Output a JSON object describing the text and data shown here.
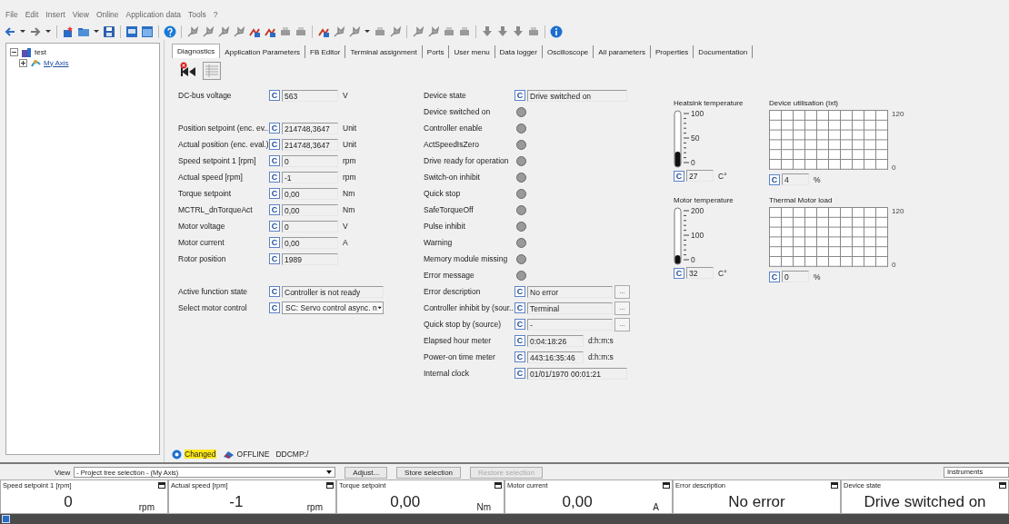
{
  "menu": [
    "File",
    "Edit",
    "Insert",
    "View",
    "Online",
    "Application data",
    "Tools",
    "?"
  ],
  "tree": [
    {
      "label": "test",
      "expanded": true,
      "children": [
        {
          "label": "My Axis",
          "expanded": false,
          "selected": true
        }
      ]
    }
  ],
  "tabs": [
    {
      "label": "Diagnostics",
      "selected": true
    },
    {
      "label": "Application Parameters",
      "selected": false
    },
    {
      "label": "FB Editor",
      "selected": false
    },
    {
      "label": "Terminal assignment",
      "selected": false
    },
    {
      "label": "Ports",
      "selected": false
    },
    {
      "label": "User menu",
      "selected": false
    },
    {
      "label": "Data logger",
      "selected": false
    },
    {
      "label": "Oscilloscope",
      "selected": false
    },
    {
      "label": "All parameters",
      "selected": false
    },
    {
      "label": "Properties",
      "selected": false
    },
    {
      "label": "Documentation",
      "selected": false
    }
  ],
  "diagnostics": {
    "rows": [
      {
        "left": {
          "kind": "value",
          "label": "DC-bus voltage",
          "flag": "C",
          "value": "563",
          "unit": "V"
        },
        "right": {
          "kind": "text",
          "label": "Device state",
          "flag": "C",
          "value": "Drive switched on"
        }
      },
      {
        "right": {
          "kind": "led",
          "label": "Device switched on",
          "on": false
        }
      },
      {
        "left": {
          "kind": "value",
          "label": "Position setpoint (enc. ev..",
          "flag": "C",
          "value": "214748,3647",
          "unit": "Unit"
        },
        "right": {
          "kind": "led",
          "label": "Controller enable",
          "on": false
        }
      },
      {
        "left": {
          "kind": "value",
          "label": "Actual position (enc. eval.)",
          "flag": "C",
          "value": "214748,3647",
          "unit": "Unit"
        },
        "right": {
          "kind": "led",
          "label": "ActSpeedIsZero",
          "on": false
        }
      },
      {
        "left": {
          "kind": "value",
          "label": "Speed setpoint 1 [rpm]",
          "flag": "C",
          "value": "0",
          "unit": "rpm"
        },
        "right": {
          "kind": "led",
          "label": "Drive ready for operation",
          "on": false
        }
      },
      {
        "left": {
          "kind": "value",
          "label": "Actual speed [rpm]",
          "flag": "C",
          "value": "-1",
          "unit": "rpm"
        },
        "right": {
          "kind": "led",
          "label": "Switch-on inhibit",
          "on": false
        }
      },
      {
        "left": {
          "kind": "value",
          "label": "Torque setpoint",
          "flag": "C",
          "value": "0,00",
          "unit": "Nm"
        },
        "right": {
          "kind": "led",
          "label": "Quick stop",
          "on": false
        }
      },
      {
        "left": {
          "kind": "value",
          "label": "MCTRL_dnTorqueAct",
          "flag": "C",
          "value": "0,00",
          "unit": "Nm"
        },
        "right": {
          "kind": "led",
          "label": "SafeTorqueOff",
          "on": false
        }
      },
      {
        "left": {
          "kind": "value",
          "label": "Motor voltage",
          "flag": "C",
          "value": "0",
          "unit": "V"
        },
        "right": {
          "kind": "led",
          "label": "Pulse inhibit",
          "on": false
        }
      },
      {
        "left": {
          "kind": "value",
          "label": "Motor current",
          "flag": "C",
          "value": "0,00",
          "unit": "A"
        },
        "right": {
          "kind": "led",
          "label": "Warning",
          "on": false
        }
      },
      {
        "left": {
          "kind": "value",
          "label": "Rotor position",
          "flag": "C",
          "value": "1989"
        },
        "right": {
          "kind": "led",
          "label": "Memory module missing",
          "on": false
        }
      },
      {
        "right": {
          "kind": "led",
          "label": "Error message",
          "on": false
        }
      },
      {
        "left": {
          "kind": "text",
          "label": "Active function state",
          "flag": "C",
          "value": "Controller is not ready"
        },
        "right": {
          "kind": "browse",
          "label": "Error description",
          "flag": "C",
          "value": "No error",
          "button": "..."
        }
      },
      {
        "left": {
          "kind": "select",
          "label": "Select motor control",
          "flag": "C",
          "value": "SC: Servo control async. n"
        },
        "right": {
          "kind": "browse",
          "label": "Controller inhibit by (sour..",
          "flag": "C",
          "value": "Terminal",
          "button": "..."
        }
      },
      {
        "right": {
          "kind": "browse",
          "label": "Quick stop by (source)",
          "flag": "C",
          "value": "-",
          "button": "..."
        }
      },
      {
        "right": {
          "kind": "value",
          "label": "Elapsed hour meter",
          "flag": "C",
          "value": "0:04:18:26",
          "unit": "d:h:m:s"
        }
      },
      {
        "right": {
          "kind": "value",
          "label": "Power-on time meter",
          "flag": "C",
          "value": "443:16:35:46",
          "unit": "d:h:m:s"
        }
      },
      {
        "right": {
          "kind": "text",
          "label": "Internal clock",
          "flag": "C",
          "value": "01/01/1970 00:01:21"
        }
      }
    ],
    "gauges": [
      {
        "thermometer": {
          "title": "Heatsink temperature",
          "ticks": [
            "100",
            "50",
            "0"
          ],
          "level": 0.27,
          "flag": "C",
          "value": "27",
          "unit": "C°"
        },
        "meter": {
          "title": "Device utilisation (Ixt)",
          "max": "120",
          "min": "0",
          "flag": "C",
          "value": "4",
          "unit": "%"
        }
      },
      {
        "thermometer": {
          "title": "Motor temperature",
          "ticks": [
            "200",
            "100",
            "0"
          ],
          "level": 0.16,
          "flag": "C",
          "value": "32",
          "unit": "C°"
        },
        "meter": {
          "title": "Thermal Motor load",
          "max": "120",
          "min": "0",
          "flag": "C",
          "value": "0",
          "unit": "%"
        }
      }
    ]
  },
  "status": [
    {
      "kind": "changed",
      "text": "Changed",
      "highlight": true
    },
    {
      "kind": "offline",
      "text": "OFFLINE",
      "highlight": false
    },
    {
      "kind": "plain",
      "text": "DDCMP:/",
      "highlight": false
    }
  ],
  "view_bar": {
    "label": "View",
    "selection": "- Project tree selection - (My Axis)",
    "buttons": [
      {
        "label": "Adjust...",
        "disabled": false
      },
      {
        "label": "Store selection",
        "disabled": false
      },
      {
        "label": "Restore selection",
        "disabled": true
      }
    ],
    "instruments": "Instruments"
  },
  "monitor": [
    {
      "title": "Speed setpoint 1 [rpm]",
      "value": "0",
      "unit": "rpm"
    },
    {
      "title": "Actual speed [rpm]",
      "value": "-1",
      "unit": "rpm"
    },
    {
      "title": "Torque setpoint",
      "value": "0,00",
      "unit": "Nm"
    },
    {
      "title": "Motor current",
      "value": "0,00",
      "unit": "A"
    },
    {
      "title": "Error description",
      "value": "No error"
    },
    {
      "title": "Device state",
      "value": "Drive switched on"
    }
  ]
}
